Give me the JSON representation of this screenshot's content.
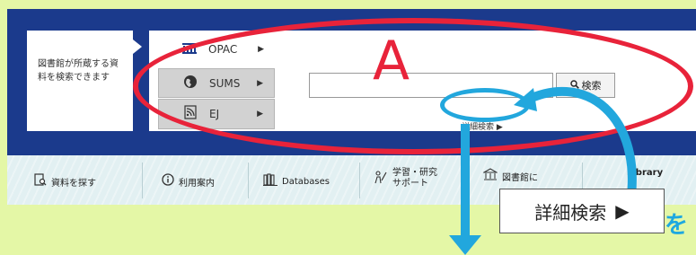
{
  "info_text": "図書館が所蔵する資料を検索できます",
  "tabs": [
    {
      "icon": "library-building-icon",
      "label": "OPAC",
      "arrow": "▶"
    },
    {
      "icon": "globe-icon",
      "label": "SUMS",
      "arrow": "▶"
    },
    {
      "icon": "rss-document-icon",
      "label": "EJ",
      "arrow": "▶"
    }
  ],
  "search": {
    "value": "",
    "button_label": "検索"
  },
  "advanced_search": "詳細検索 ▶",
  "nav": [
    {
      "icon": "document-search-icon",
      "label": "資料を探す"
    },
    {
      "icon": "info-circle-icon",
      "label": "利用案内"
    },
    {
      "icon": "books-icon",
      "label": "Databases"
    },
    {
      "icon": "study-person-icon",
      "label": "学習・研究サポート"
    },
    {
      "icon": "library-icon",
      "label": "図書館に"
    },
    {
      "icon": "",
      "label": "Library"
    }
  ],
  "annotation": {
    "label": "A",
    "callout_text": "詳細検索",
    "callout_arrow": "▶",
    "trailing_text": "を",
    "colors": {
      "red": "#e8233a",
      "blue": "#22a7dd"
    }
  }
}
